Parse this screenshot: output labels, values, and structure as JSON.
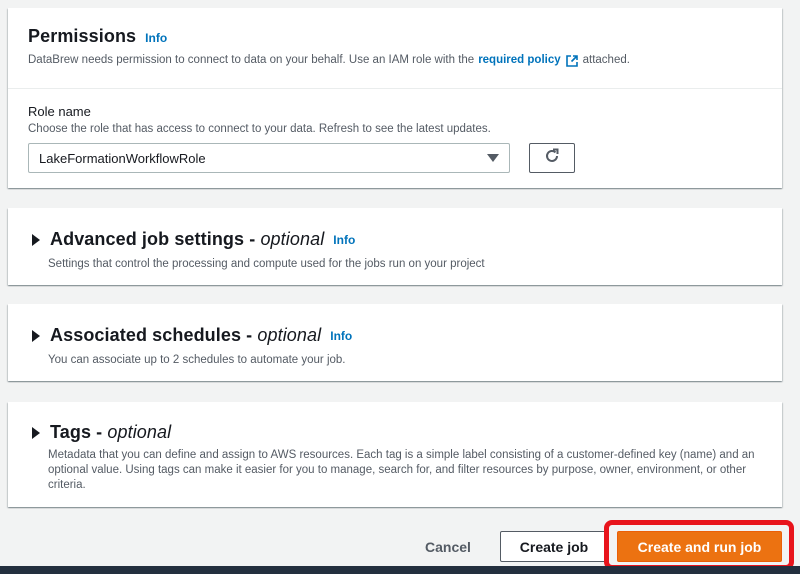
{
  "permissions": {
    "title": "Permissions",
    "info": "Info",
    "description_prefix": "DataBrew needs permission to connect to data on your behalf. Use an IAM role with the",
    "policy_link": "required policy",
    "description_suffix": "attached.",
    "role": {
      "label": "Role name",
      "description": "Choose the role that has access to connect to your data. Refresh to see the latest updates.",
      "selected": "LakeFormationWorkflowRole"
    }
  },
  "advanced": {
    "title": "Advanced job settings - ",
    "optional": "optional",
    "info": "Info",
    "description": "Settings that control the processing and compute used for the jobs run on your project"
  },
  "schedules": {
    "title": "Associated schedules - ",
    "optional": "optional",
    "info": "Info",
    "description": "You can associate up to 2 schedules to automate your job."
  },
  "tags": {
    "title": "Tags - ",
    "optional": "optional",
    "description": "Metadata that you can define and assign to AWS resources. Each tag is a simple label consisting of a customer-defined key (name) and an optional value. Using tags can make it easier for you to manage, search for, and filter resources by purpose, owner, environment, or other criteria."
  },
  "footer": {
    "cancel": "Cancel",
    "create": "Create job",
    "create_run": "Create and run job"
  },
  "colors": {
    "primary": "#ec7211",
    "link": "#0073bb",
    "highlight": "#e8141c"
  },
  "icons": {
    "external": "external-link-icon",
    "refresh": "refresh-icon",
    "dropdown": "caret-down-icon",
    "expand": "caret-right-icon"
  }
}
